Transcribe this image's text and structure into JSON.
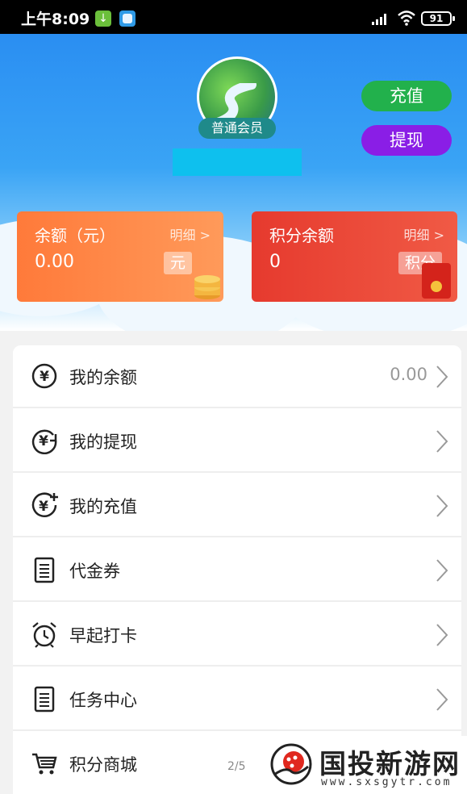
{
  "status_bar": {
    "time": "上午8:09",
    "battery": "91"
  },
  "header": {
    "member_level": "普通会员",
    "recharge_label": "充值",
    "withdraw_label": "提现"
  },
  "cards": {
    "balance": {
      "title": "余额（元）",
      "detail": "明细 >",
      "value": "0.00",
      "unit": "元"
    },
    "points": {
      "title": "积分余额",
      "detail": "明细 >",
      "value": "0",
      "unit": "积分"
    }
  },
  "menu": {
    "items": [
      {
        "label": "我的余额",
        "value": "0.00",
        "icon": "yuan-circle-icon"
      },
      {
        "label": "我的提现",
        "value": "",
        "icon": "yuan-withdraw-icon"
      },
      {
        "label": "我的充值",
        "value": "",
        "icon": "yuan-recharge-icon"
      },
      {
        "label": "代金券",
        "value": "",
        "icon": "clipboard-icon"
      },
      {
        "label": "早起打卡",
        "value": "",
        "icon": "alarm-clock-icon"
      },
      {
        "label": "任务中心",
        "value": "",
        "icon": "clipboard-icon"
      },
      {
        "label": "积分商城",
        "value": "",
        "icon": "cart-icon"
      }
    ]
  },
  "page_indicator": "2/5",
  "watermark": {
    "name": "国投新游网",
    "url": "www.sxsgytr.com"
  },
  "colors": {
    "recharge": "#22b14c",
    "withdraw": "#8a1ee6",
    "balance_card": "#ff7a3a",
    "points_card": "#e63a2e",
    "username_bar": "#0ec0ee"
  }
}
